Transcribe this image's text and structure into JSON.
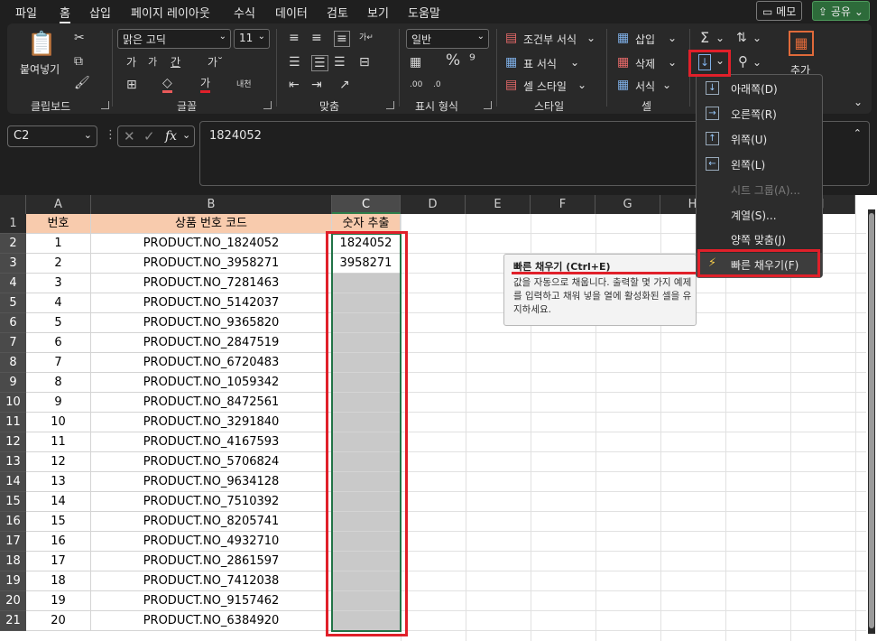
{
  "menu": {
    "items": [
      "파일",
      "홈",
      "삽입",
      "페이지 레이아웃",
      "수식",
      "데이터",
      "검토",
      "보기",
      "도움말"
    ],
    "active": "홈",
    "memo": "메모",
    "share": "공유"
  },
  "ribbon": {
    "clipboard": {
      "paste": "붙여넣기",
      "label": "클립보드"
    },
    "font": {
      "name": "맑은 고딕",
      "size": "11",
      "label": "글꼴"
    },
    "alignment": {
      "label": "맞춤"
    },
    "number": {
      "format": "일반",
      "label": "표시 형식"
    },
    "styles": {
      "conditional": "조건부 서식",
      "table": "표 서식",
      "cell": "셀 스타일",
      "label": "스타일"
    },
    "cells": {
      "insert": "삽입",
      "delete": "삭제",
      "format": "서식",
      "label": "셀"
    },
    "editing": {
      "add": "추가"
    }
  },
  "formula_bar": {
    "name_box": "C2",
    "fx": "fx",
    "value": "1824052"
  },
  "columns": [
    "A",
    "B",
    "C",
    "D",
    "E",
    "F",
    "G",
    "H",
    "I",
    "J"
  ],
  "headers": {
    "a": "번호",
    "b": "상품 번호 코드",
    "c": "숫자 추출"
  },
  "rows": [
    {
      "n": "1",
      "code": "PRODUCT.NO_1824052",
      "num": "1824052"
    },
    {
      "n": "2",
      "code": "PRODUCT.NO_3958271",
      "num": "3958271"
    },
    {
      "n": "3",
      "code": "PRODUCT.NO_7281463",
      "num": ""
    },
    {
      "n": "4",
      "code": "PRODUCT.NO_5142037",
      "num": ""
    },
    {
      "n": "5",
      "code": "PRODUCT.NO_9365820",
      "num": ""
    },
    {
      "n": "6",
      "code": "PRODUCT.NO_2847519",
      "num": ""
    },
    {
      "n": "7",
      "code": "PRODUCT.NO_6720483",
      "num": ""
    },
    {
      "n": "8",
      "code": "PRODUCT.NO_1059342",
      "num": ""
    },
    {
      "n": "9",
      "code": "PRODUCT.NO_8472561",
      "num": ""
    },
    {
      "n": "10",
      "code": "PRODUCT.NO_3291840",
      "num": ""
    },
    {
      "n": "11",
      "code": "PRODUCT.NO_4167593",
      "num": ""
    },
    {
      "n": "12",
      "code": "PRODUCT.NO_5706824",
      "num": ""
    },
    {
      "n": "13",
      "code": "PRODUCT.NO_9634128",
      "num": ""
    },
    {
      "n": "14",
      "code": "PRODUCT.NO_7510392",
      "num": ""
    },
    {
      "n": "15",
      "code": "PRODUCT.NO_8205741",
      "num": ""
    },
    {
      "n": "16",
      "code": "PRODUCT.NO_4932710",
      "num": ""
    },
    {
      "n": "17",
      "code": "PRODUCT.NO_2861597",
      "num": ""
    },
    {
      "n": "18",
      "code": "PRODUCT.NO_7412038",
      "num": ""
    },
    {
      "n": "19",
      "code": "PRODUCT.NO_9157462",
      "num": ""
    },
    {
      "n": "20",
      "code": "PRODUCT.NO_6384920",
      "num": ""
    }
  ],
  "fill_menu": [
    {
      "label": "아래쪽(D)",
      "icon": "arrow-down-icon",
      "glyph": "↓",
      "disabled": false
    },
    {
      "label": "오른쪽(R)",
      "icon": "arrow-right-icon",
      "glyph": "→",
      "disabled": false
    },
    {
      "label": "위쪽(U)",
      "icon": "arrow-up-icon",
      "glyph": "↑",
      "disabled": false
    },
    {
      "label": "왼쪽(L)",
      "icon": "arrow-left-icon",
      "glyph": "←",
      "disabled": false
    },
    {
      "label": "시트 그룹(A)...",
      "icon": "",
      "glyph": "",
      "disabled": true
    },
    {
      "label": "계열(S)...",
      "icon": "",
      "glyph": "",
      "disabled": false
    },
    {
      "label": "양쪽 맞춤(J)",
      "icon": "",
      "glyph": "",
      "disabled": false
    },
    {
      "label": "빠른 채우기(F)",
      "icon": "flash-fill-icon",
      "glyph": "⚡",
      "disabled": false
    }
  ],
  "tooltip": {
    "title": "빠른 채우기 (Ctrl+E)",
    "body": "값을 자동으로 채웁니다. 출력할 몇 가지 예제를 입력하고 채워 넣을 열에 활성화된 셀을 유지하세요."
  },
  "colors": {
    "header_fill": "#f8cbad",
    "selection": "#217346",
    "highlight": "#e0202a"
  }
}
